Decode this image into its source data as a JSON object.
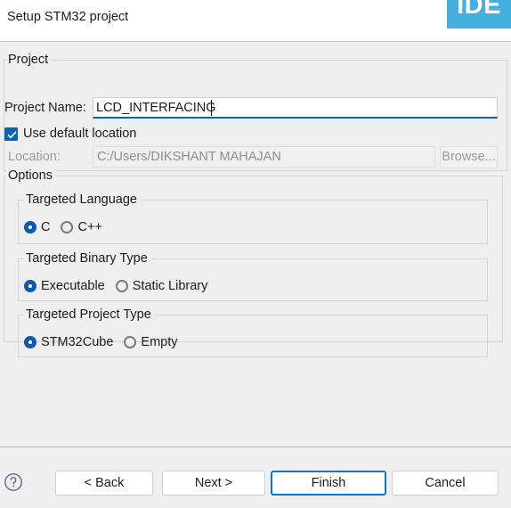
{
  "header": {
    "title": "Setup STM32 project",
    "logo_text": "IDE",
    "logo_color": "#45b0e0"
  },
  "project": {
    "group_label": "Project",
    "name_label": "Project Name:",
    "name_value": "LCD_INTERFACING",
    "name_placeholder": "",
    "use_default_location_label": "Use default location",
    "use_default_location_checked": true,
    "location_label": "Location:",
    "location_value": "C:/Users/DIKSHANT MAHAJAN",
    "browse_label": "Browse...",
    "browse_enabled": false
  },
  "options": {
    "group_label": "Options",
    "language": {
      "legend": "Targeted Language",
      "choices": [
        {
          "label": "C",
          "selected": true
        },
        {
          "label": "C++",
          "selected": false
        }
      ]
    },
    "binary_type": {
      "legend": "Targeted Binary Type",
      "choices": [
        {
          "label": "Executable",
          "selected": true
        },
        {
          "label": "Static Library",
          "selected": false
        }
      ]
    },
    "project_type": {
      "legend": "Targeted Project Type",
      "choices": [
        {
          "label": "STM32Cube",
          "selected": true
        },
        {
          "label": "Empty",
          "selected": false
        }
      ]
    }
  },
  "footer": {
    "help_icon": "question-mark-circle-icon",
    "back_label": "< Back",
    "next_label": "Next >",
    "finish_label": "Finish",
    "cancel_label": "Cancel",
    "default_button": "Finish"
  },
  "colors": {
    "accent_blue": "#0a5bb4",
    "focus_blue": "#0a64b4",
    "logo_blue": "#45b0e0",
    "window_bg": "#efefef"
  }
}
